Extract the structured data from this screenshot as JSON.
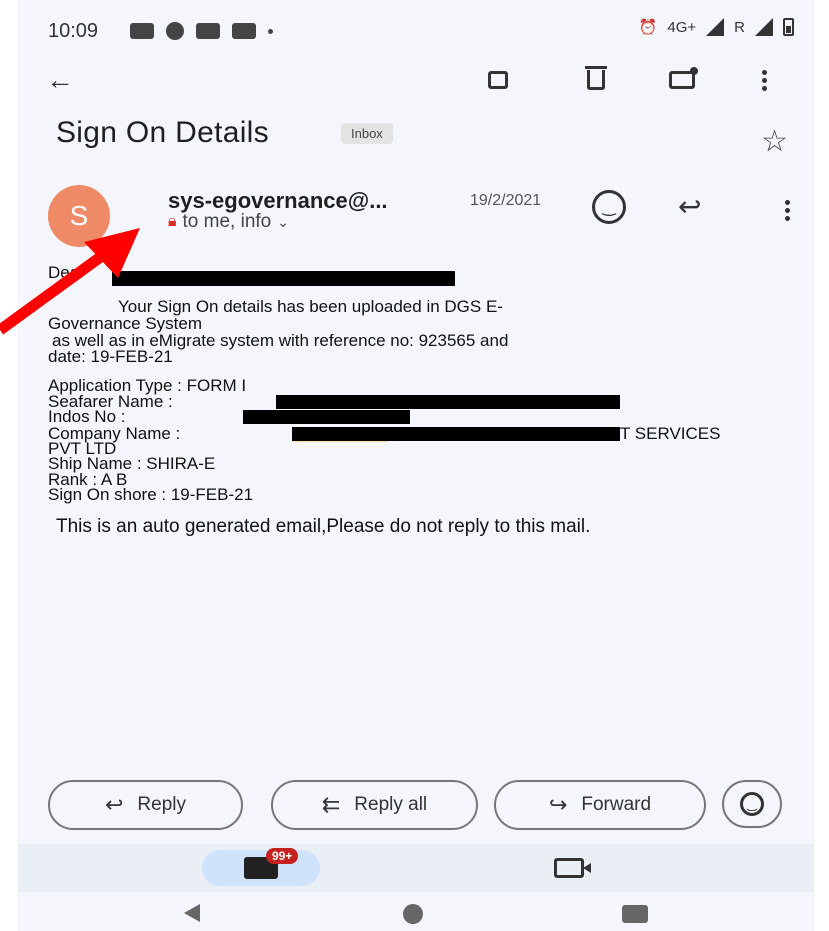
{
  "status_bar": {
    "time": "10:09",
    "network": "4G+",
    "sim_label": "R"
  },
  "toolbar": {
    "back_icon": "back-arrow-icon",
    "archive_icon": "archive-icon",
    "delete_icon": "trash-icon",
    "mark_unread_icon": "mail-unread-icon",
    "more_icon": "more-vert-icon"
  },
  "email": {
    "subject": "Sign On Details",
    "label": "Inbox",
    "sender_initial": "S",
    "sender": "sys-egovernance@...",
    "date": "19/2/2021",
    "recipients": "to me, info",
    "body": {
      "greeting": "Dear",
      "para1_line1": "Your Sign On details has been uploaded in DGS E-",
      "para1_line2": "Governance System",
      "para1_line3": "as well as in eMigrate system with reference no: 923565 and",
      "para1_line4": "date: 19-FEB-21",
      "app_type": "Application Type   : FORM I",
      "seafarer": "Seafarer Name       :",
      "indos": "Indos No              :",
      "company": "Company  Name       :",
      "company_tail": "T SERVICES",
      "company_line2": "PVT LTD",
      "ship": "Ship Name          : SHIRA-E",
      "rank": "Rank                : A B",
      "sign_on": "Sign On shore       : 19-FEB-21",
      "footer": "This is an auto generated email,Please do not reply to this mail."
    }
  },
  "actions": {
    "reply": "Reply",
    "reply_all": "Reply all",
    "forward": "Forward"
  },
  "bottom_nav": {
    "mail_badge": "99+"
  },
  "colors": {
    "avatar": "#ef8a66",
    "annotation_arrow": "#ff0000",
    "badge": "#c5221f"
  }
}
